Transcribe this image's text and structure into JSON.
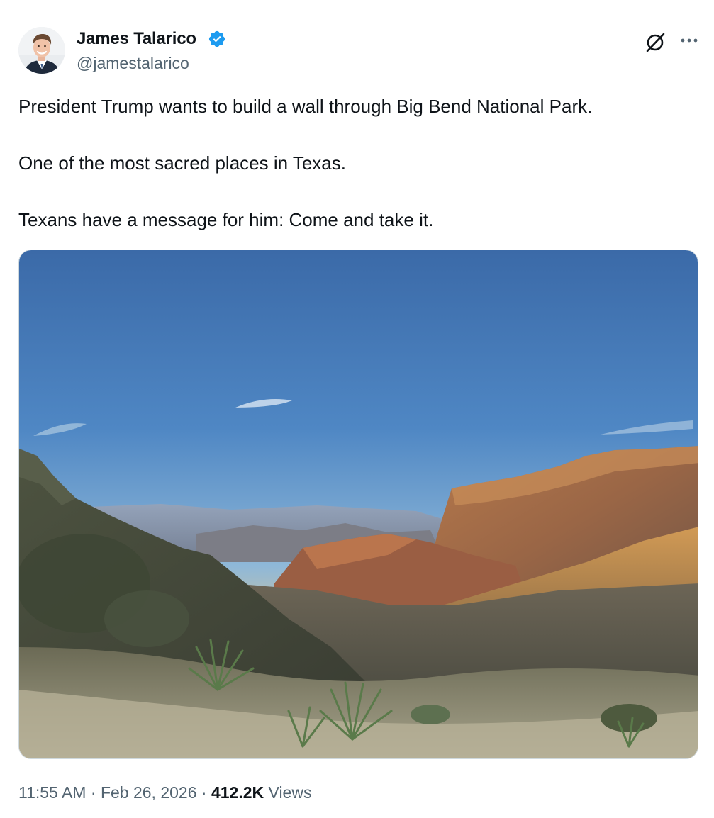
{
  "author": {
    "display_name": "James Talarico",
    "handle": "@jamestalarico",
    "verified_color": "#1d9bf0"
  },
  "header_actions": {
    "grok_icon": "grok-icon",
    "more_icon": "more-icon"
  },
  "tweet": {
    "paragraphs": [
      "President Trump wants to build a wall through Big Bend National Park.",
      "One of the most sacred places in Texas.",
      "Texans have a message for him: Come and take it."
    ]
  },
  "media": {
    "type": "photo"
  },
  "meta": {
    "time": "11:55 AM",
    "separator": "·",
    "date": "Feb 26, 2026",
    "views_count": "412.2K",
    "views_label": "Views"
  },
  "colors": {
    "text_primary": "#0f1419",
    "text_secondary": "#536471",
    "border": "#cfd9de",
    "accent": "#1d9bf0"
  }
}
